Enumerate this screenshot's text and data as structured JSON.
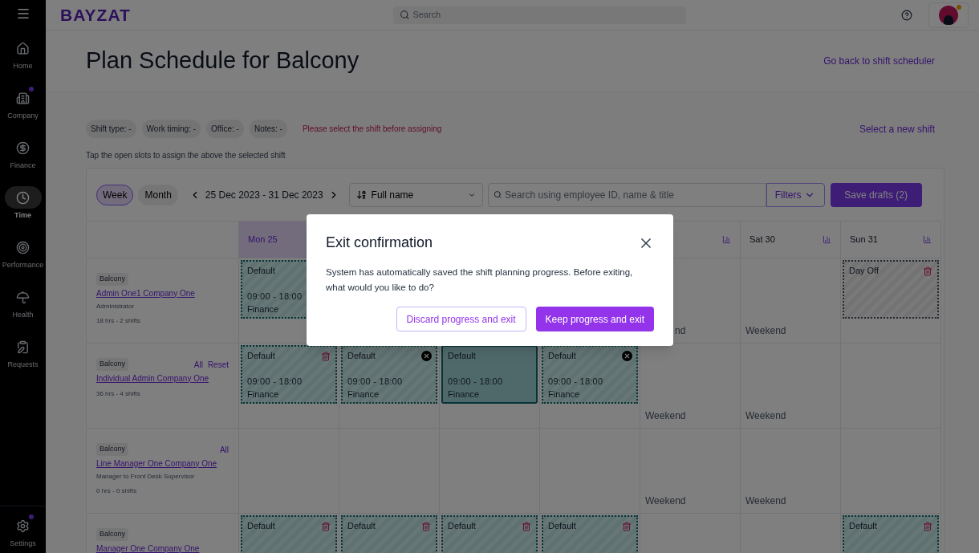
{
  "sidebar": {
    "items": [
      {
        "kind": "home",
        "label": "Home",
        "selected": false,
        "badge": false
      },
      {
        "kind": "company",
        "label": "Company",
        "selected": false,
        "badge": true
      },
      {
        "kind": "finance",
        "label": "Finance",
        "selected": false,
        "badge": false
      },
      {
        "kind": "time",
        "label": "Time",
        "selected": true,
        "badge": false
      },
      {
        "kind": "performance",
        "label": "Performance",
        "selected": false,
        "badge": false
      },
      {
        "kind": "health",
        "label": "Health",
        "selected": false,
        "badge": false
      },
      {
        "kind": "requests",
        "label": "Requests",
        "selected": false,
        "badge": false
      }
    ],
    "footer": {
      "kind": "settings",
      "label": "Settings",
      "selected": false,
      "badge": true
    }
  },
  "topbar": {
    "logo": "BAYZAT",
    "search": {
      "placeholder": "Search"
    },
    "avatar_badge": true
  },
  "page": {
    "title": "Plan Schedule for Balcony",
    "back_link": "Go back to shift scheduler"
  },
  "shift_info": {
    "chips": [
      "Shift type: -",
      "Work timing: -",
      "Office: -",
      "Notes: -"
    ],
    "warning": "Please select the shift before assigning",
    "new_shift_link": "Select a new shift",
    "hint": "Tap the open slots to assign the above the selected shift"
  },
  "toolbar": {
    "views": [
      {
        "label": "Week",
        "selected": true
      },
      {
        "label": "Month",
        "selected": false
      }
    ],
    "range": "25 Dec 2023 - 31 Dec 2023",
    "sort": "Full name",
    "search": {
      "placeholder": "Search using employee ID, name & title"
    },
    "filters": "Filters",
    "save": "Save drafts (2)"
  },
  "schedule": {
    "days": [
      {
        "kind": "label_only",
        "label": "Mon 25",
        "selected": true
      },
      {
        "kind": "covered"
      },
      {
        "kind": "covered"
      },
      {
        "kind": "covered"
      },
      {
        "kind": "icon_only",
        "selected": false
      },
      {
        "kind": "day",
        "label": "Sat 30",
        "selected": false
      },
      {
        "kind": "day",
        "label": "Sun 31",
        "selected": false
      }
    ],
    "rows": [
      {
        "office": "Balcony",
        "name": "Admin One1 Company One",
        "title": "Administrator",
        "summary": "18 hrs - 2 shifts",
        "actions": [],
        "cells": [
          {
            "kind": "shift",
            "label": "Default",
            "time": "09:00 - 18:00",
            "dept": "Finance",
            "selected": false
          },
          {
            "kind": "covered"
          },
          {
            "kind": "covered"
          },
          {
            "kind": "covered"
          },
          {
            "kind": "weekend_clipped",
            "label": "nd"
          },
          {
            "kind": "weekend",
            "label": "Weekend"
          },
          {
            "kind": "day_off",
            "label": "Day Off",
            "selected": false
          }
        ]
      },
      {
        "office": "Balcony",
        "name": "Individual Admin Company One",
        "summary": "36 hrs - 4 shifts",
        "actions": [
          "All",
          "Reset"
        ],
        "cells": [
          {
            "kind": "draft_shift",
            "label": "Default",
            "time": "09:00 - 18:00",
            "dept": "Finance",
            "selected": false
          },
          {
            "kind": "saved_shift",
            "label": "Default",
            "time": "09:00 - 18:00",
            "dept": "Finance",
            "selected": false
          },
          {
            "kind": "shift",
            "label": "Default",
            "time": "09:00 - 18:00",
            "dept": "Finance",
            "selected": true
          },
          {
            "kind": "saved_shift",
            "label": "Default",
            "time": "09:00 - 18:00",
            "dept": "Finance",
            "selected": false
          },
          {
            "kind": "weekend",
            "label": "Weekend"
          },
          {
            "kind": "weekend",
            "label": "Weekend"
          },
          {
            "kind": "empty"
          }
        ]
      },
      {
        "office": "Balcony",
        "name": "Line Manager One Company One",
        "title": "Manager to Front Desk Supervisor",
        "summary": "0 hrs - 0 shifts",
        "actions": [
          "All"
        ],
        "cells": [
          {
            "kind": "empty"
          },
          {
            "kind": "empty"
          },
          {
            "kind": "empty"
          },
          {
            "kind": "empty"
          },
          {
            "kind": "weekend",
            "label": "Weekend"
          },
          {
            "kind": "weekend",
            "label": "Weekend"
          },
          {
            "kind": "empty"
          }
        ]
      },
      {
        "office": "Balcony",
        "name": "Manager One Company One",
        "actions": [],
        "cells": [
          {
            "kind": "draft_shift",
            "label": "Default",
            "selected": false
          },
          {
            "kind": "draft_shift",
            "label": "Default",
            "selected": false
          },
          {
            "kind": "draft_shift",
            "label": "Default",
            "selected": false
          },
          {
            "kind": "draft_shift",
            "label": "Default",
            "selected": false
          },
          {
            "kind": "empty"
          },
          {
            "kind": "empty"
          },
          {
            "kind": "draft_shift",
            "label": "Default",
            "selected": false
          }
        ]
      }
    ]
  },
  "dialog": {
    "title": "Exit confirmation",
    "message": "System has automatically saved the shift planning progress. Before exiting, what would you like to do?",
    "buttons": [
      {
        "kind": "secondary",
        "label": "Discard progress and exit"
      },
      {
        "kind": "primary",
        "label": "Keep progress and exit"
      }
    ]
  }
}
